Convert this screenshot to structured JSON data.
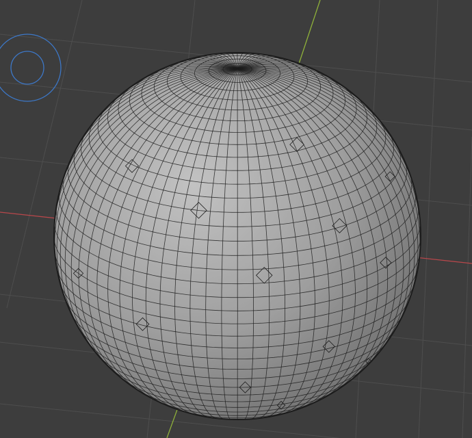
{
  "viewport": {
    "background_color": "#3d3d3d",
    "grid_color": "#4e4e4e",
    "x_axis_color": "#b8474b",
    "y_axis_color": "#8fb13a",
    "light_gizmo_color": "#3d78c8",
    "light_gizmo_icon": "sun-light-gizmo-icon"
  },
  "object": {
    "type": "quadriflow-remeshed-sphere",
    "base_color": "#9e9e9e",
    "highlight_color": "#c2c2c2",
    "shadow_color": "#6a6a6a",
    "wire_color": "#1c1c1c"
  }
}
